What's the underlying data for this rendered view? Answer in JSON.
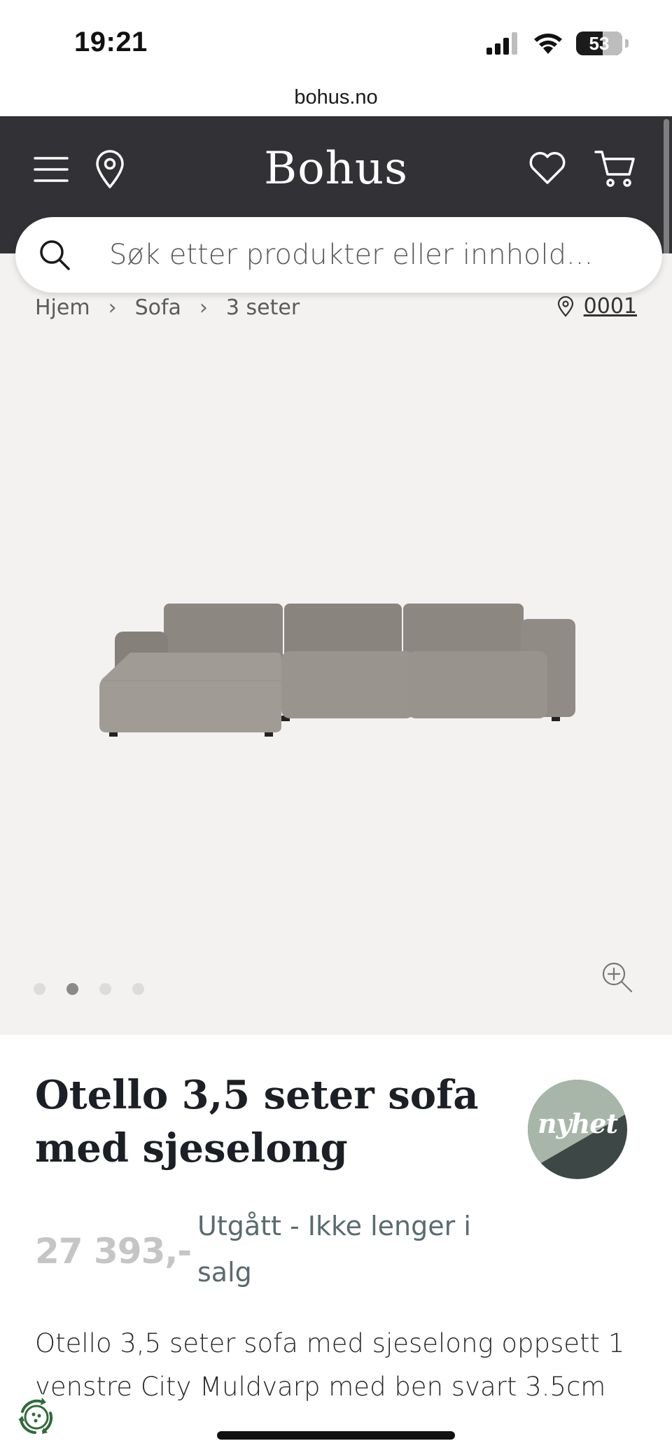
{
  "status_bar": {
    "time": "19:21",
    "battery": "53",
    "icons": [
      "cellular-signal-icon",
      "wifi-icon",
      "battery-icon"
    ]
  },
  "browser": {
    "url": "bohus.no"
  },
  "header": {
    "brand": "Bohus",
    "background_color": "#323236",
    "icons": [
      "menu-icon",
      "location-pin-icon",
      "heart-icon",
      "cart-icon"
    ]
  },
  "search": {
    "placeholder": "Søk etter produkter eller innhold..."
  },
  "breadcrumb": {
    "items": [
      "Hjem",
      "Sofa",
      "3 seter"
    ],
    "store_number": "0001"
  },
  "gallery": {
    "image_count": 4,
    "active_index": 1,
    "background_color": "#f3f2f0"
  },
  "product": {
    "title": "Otello 3,5 seter sofa med sjeselong",
    "badge": "nyhet",
    "price": "27 393,-",
    "availability": "Utgått - Ikke lenger i salg",
    "description": "Otello 3,5 seter sofa med sjeselong oppsett 1 venstre City Muldvarp med ben svart 3.5cm"
  }
}
